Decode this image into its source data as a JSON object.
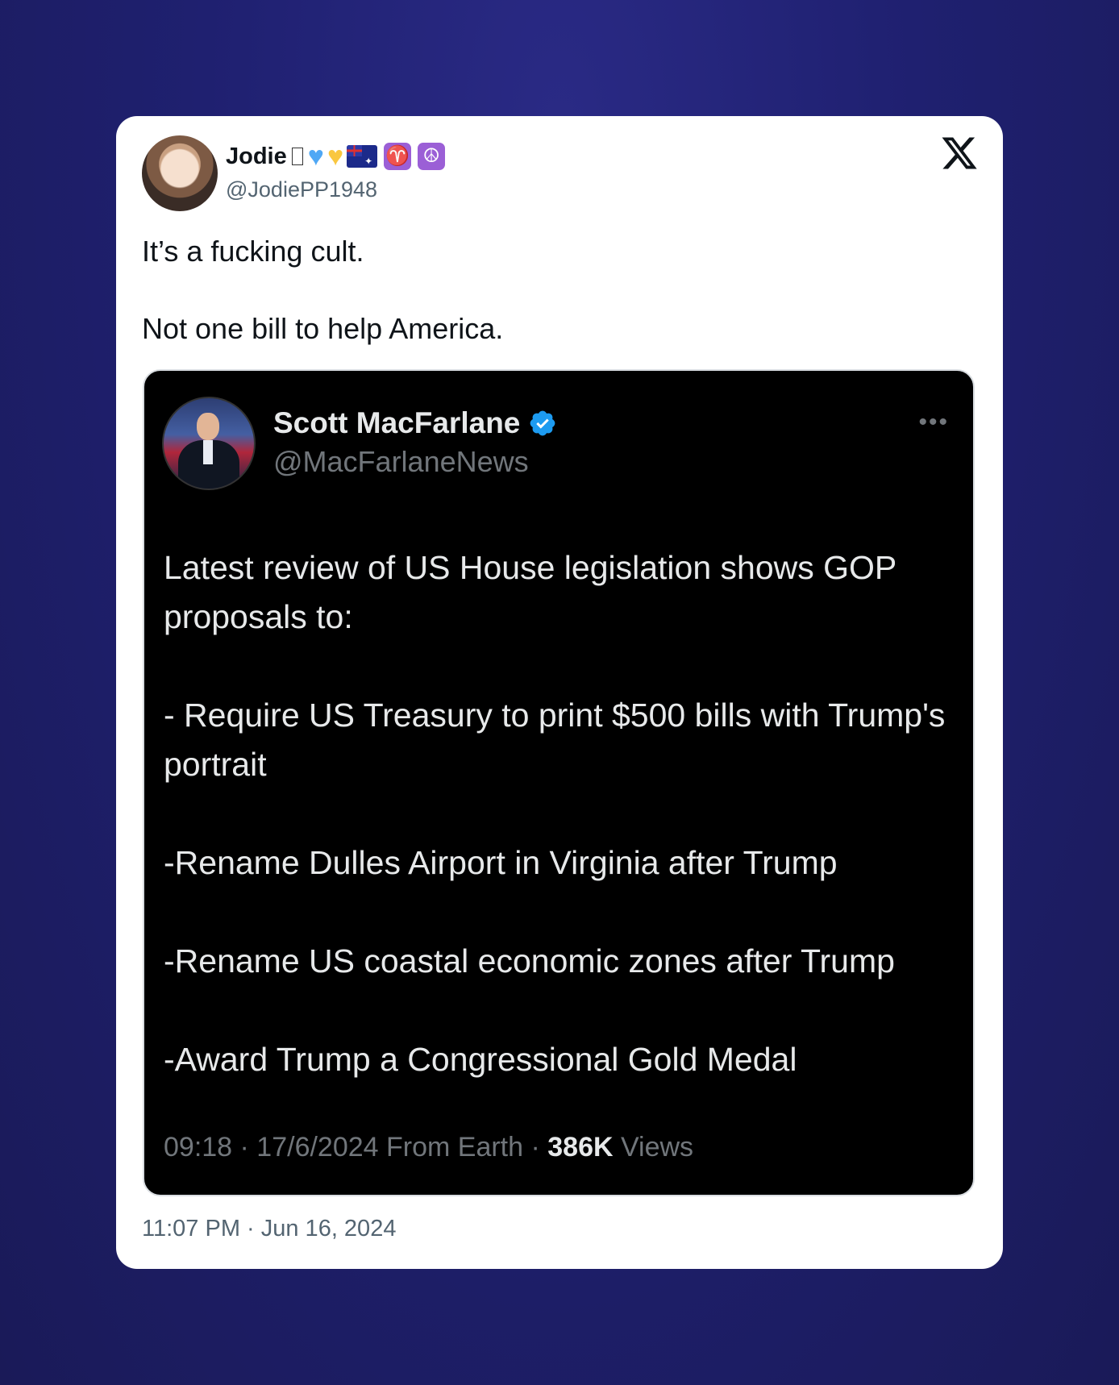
{
  "tweet": {
    "author_name": "Jodie",
    "author_handle": "@JodiePP1948",
    "name_emojis": [
      "tofu-glyph",
      "blue-heart",
      "yellow-heart",
      "australia-flag",
      "aries-symbol",
      "peace-symbol"
    ],
    "paragraphs": [
      "It’s a fucking cult.",
      "Not one bill to help America."
    ],
    "timestamp": "11:07 PM · Jun 16, 2024",
    "brand_icon": "x-logo-icon"
  },
  "embedded": {
    "author_name": "Scott MacFarlane",
    "author_handle": "@MacFarlaneNews",
    "verified": true,
    "paragraphs": [
      "Latest review of US House legislation shows GOP proposals to:",
      "- Require US Treasury to print $500 bills with Trump's portrait",
      "-Rename Dulles Airport in Virginia after Trump",
      "-Rename US coastal economic zones after Trump",
      "-Award Trump a Congressional Gold Medal"
    ],
    "meta_prefix": "09:18 · 17/6/2024 From Earth · ",
    "views_count": "386K",
    "views_label": " Views"
  },
  "colors": {
    "background": "#1f2070",
    "card": "#ffffff",
    "embed_background": "#000000",
    "verified_badge": "#1d9bf0"
  }
}
